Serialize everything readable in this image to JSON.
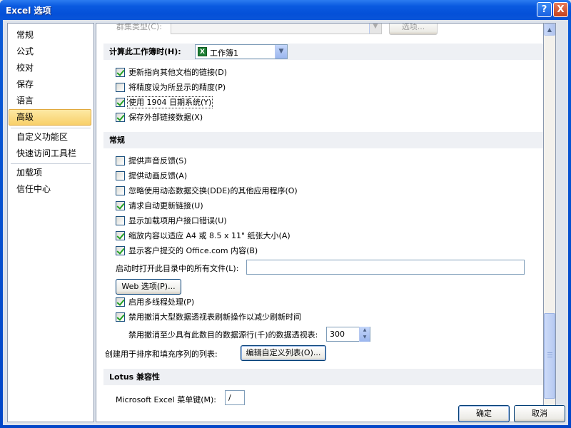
{
  "window": {
    "title": "Excel 选项"
  },
  "titlebar": {
    "help_label": "?",
    "close_label": "X"
  },
  "nav": {
    "items": [
      {
        "label": "常规"
      },
      {
        "label": "公式"
      },
      {
        "label": "校对"
      },
      {
        "label": "保存"
      },
      {
        "label": "语言"
      },
      {
        "label": "高级",
        "active": true
      },
      {
        "label": "自定义功能区"
      },
      {
        "label": "快速访问工具栏"
      },
      {
        "label": "加载项"
      },
      {
        "label": "信任中心"
      }
    ]
  },
  "main": {
    "top_partial": {
      "label": "群集类型(C):",
      "button": "选项..."
    },
    "calc_section": {
      "label": "计算此工作簿时(H):",
      "workbook_value": "工作簿1",
      "options": [
        {
          "label": "更新指向其他文档的链接(D)",
          "checked": true
        },
        {
          "label": "将精度设为所显示的精度(P)",
          "checked": false
        },
        {
          "label": "使用 1904 日期系统(Y)",
          "checked": true
        },
        {
          "label": "保存外部链接数据(X)",
          "checked": true
        }
      ]
    },
    "general_section": {
      "header": "常规",
      "options": [
        {
          "label": "提供声音反馈(S)",
          "checked": false
        },
        {
          "label": "提供动画反馈(A)",
          "checked": false
        },
        {
          "label": "忽略使用动态数据交换(DDE)的其他应用程序(O)",
          "checked": false
        },
        {
          "label": "请求自动更新链接(U)",
          "checked": true
        },
        {
          "label": "显示加载项用户接口错误(U)",
          "checked": false
        },
        {
          "label": "缩放内容以适应 A4 或 8.5 x 11\" 纸张大小(A)",
          "checked": true
        },
        {
          "label": "显示客户提交的 Office.com 内容(B)",
          "checked": true
        }
      ],
      "startup_label": "启动时打开此目录中的所有文件(L):",
      "startup_value": "",
      "web_options_button": "Web 选项(P)...",
      "options2": [
        {
          "label": "启用多线程处理(P)",
          "checked": true
        },
        {
          "label": "禁用撤消大型数据透视表刷新操作以减少刷新时间",
          "checked": true
        }
      ],
      "undo_rows_label": "禁用撤消至少具有此数目的数据源行(千)的数据透视表:",
      "undo_rows_value": "300",
      "custom_lists_label": "创建用于排序和填充序列的列表:",
      "edit_custom_lists_button": "编辑自定义列表(O)..."
    },
    "lotus_section": {
      "header": "Lotus 兼容性",
      "menu_key_label": "Microsoft Excel 菜单键(M):",
      "menu_key_value": "/"
    }
  },
  "footer": {
    "ok_label": "确定",
    "cancel_label": "取消"
  },
  "colors": {
    "titlebar": "#0a5ae0",
    "nav_active": "#f8d06a",
    "checkmark": "#21a121"
  },
  "icons": {
    "workbook": "excel-workbook-icon",
    "help": "help-icon",
    "close": "close-icon"
  }
}
